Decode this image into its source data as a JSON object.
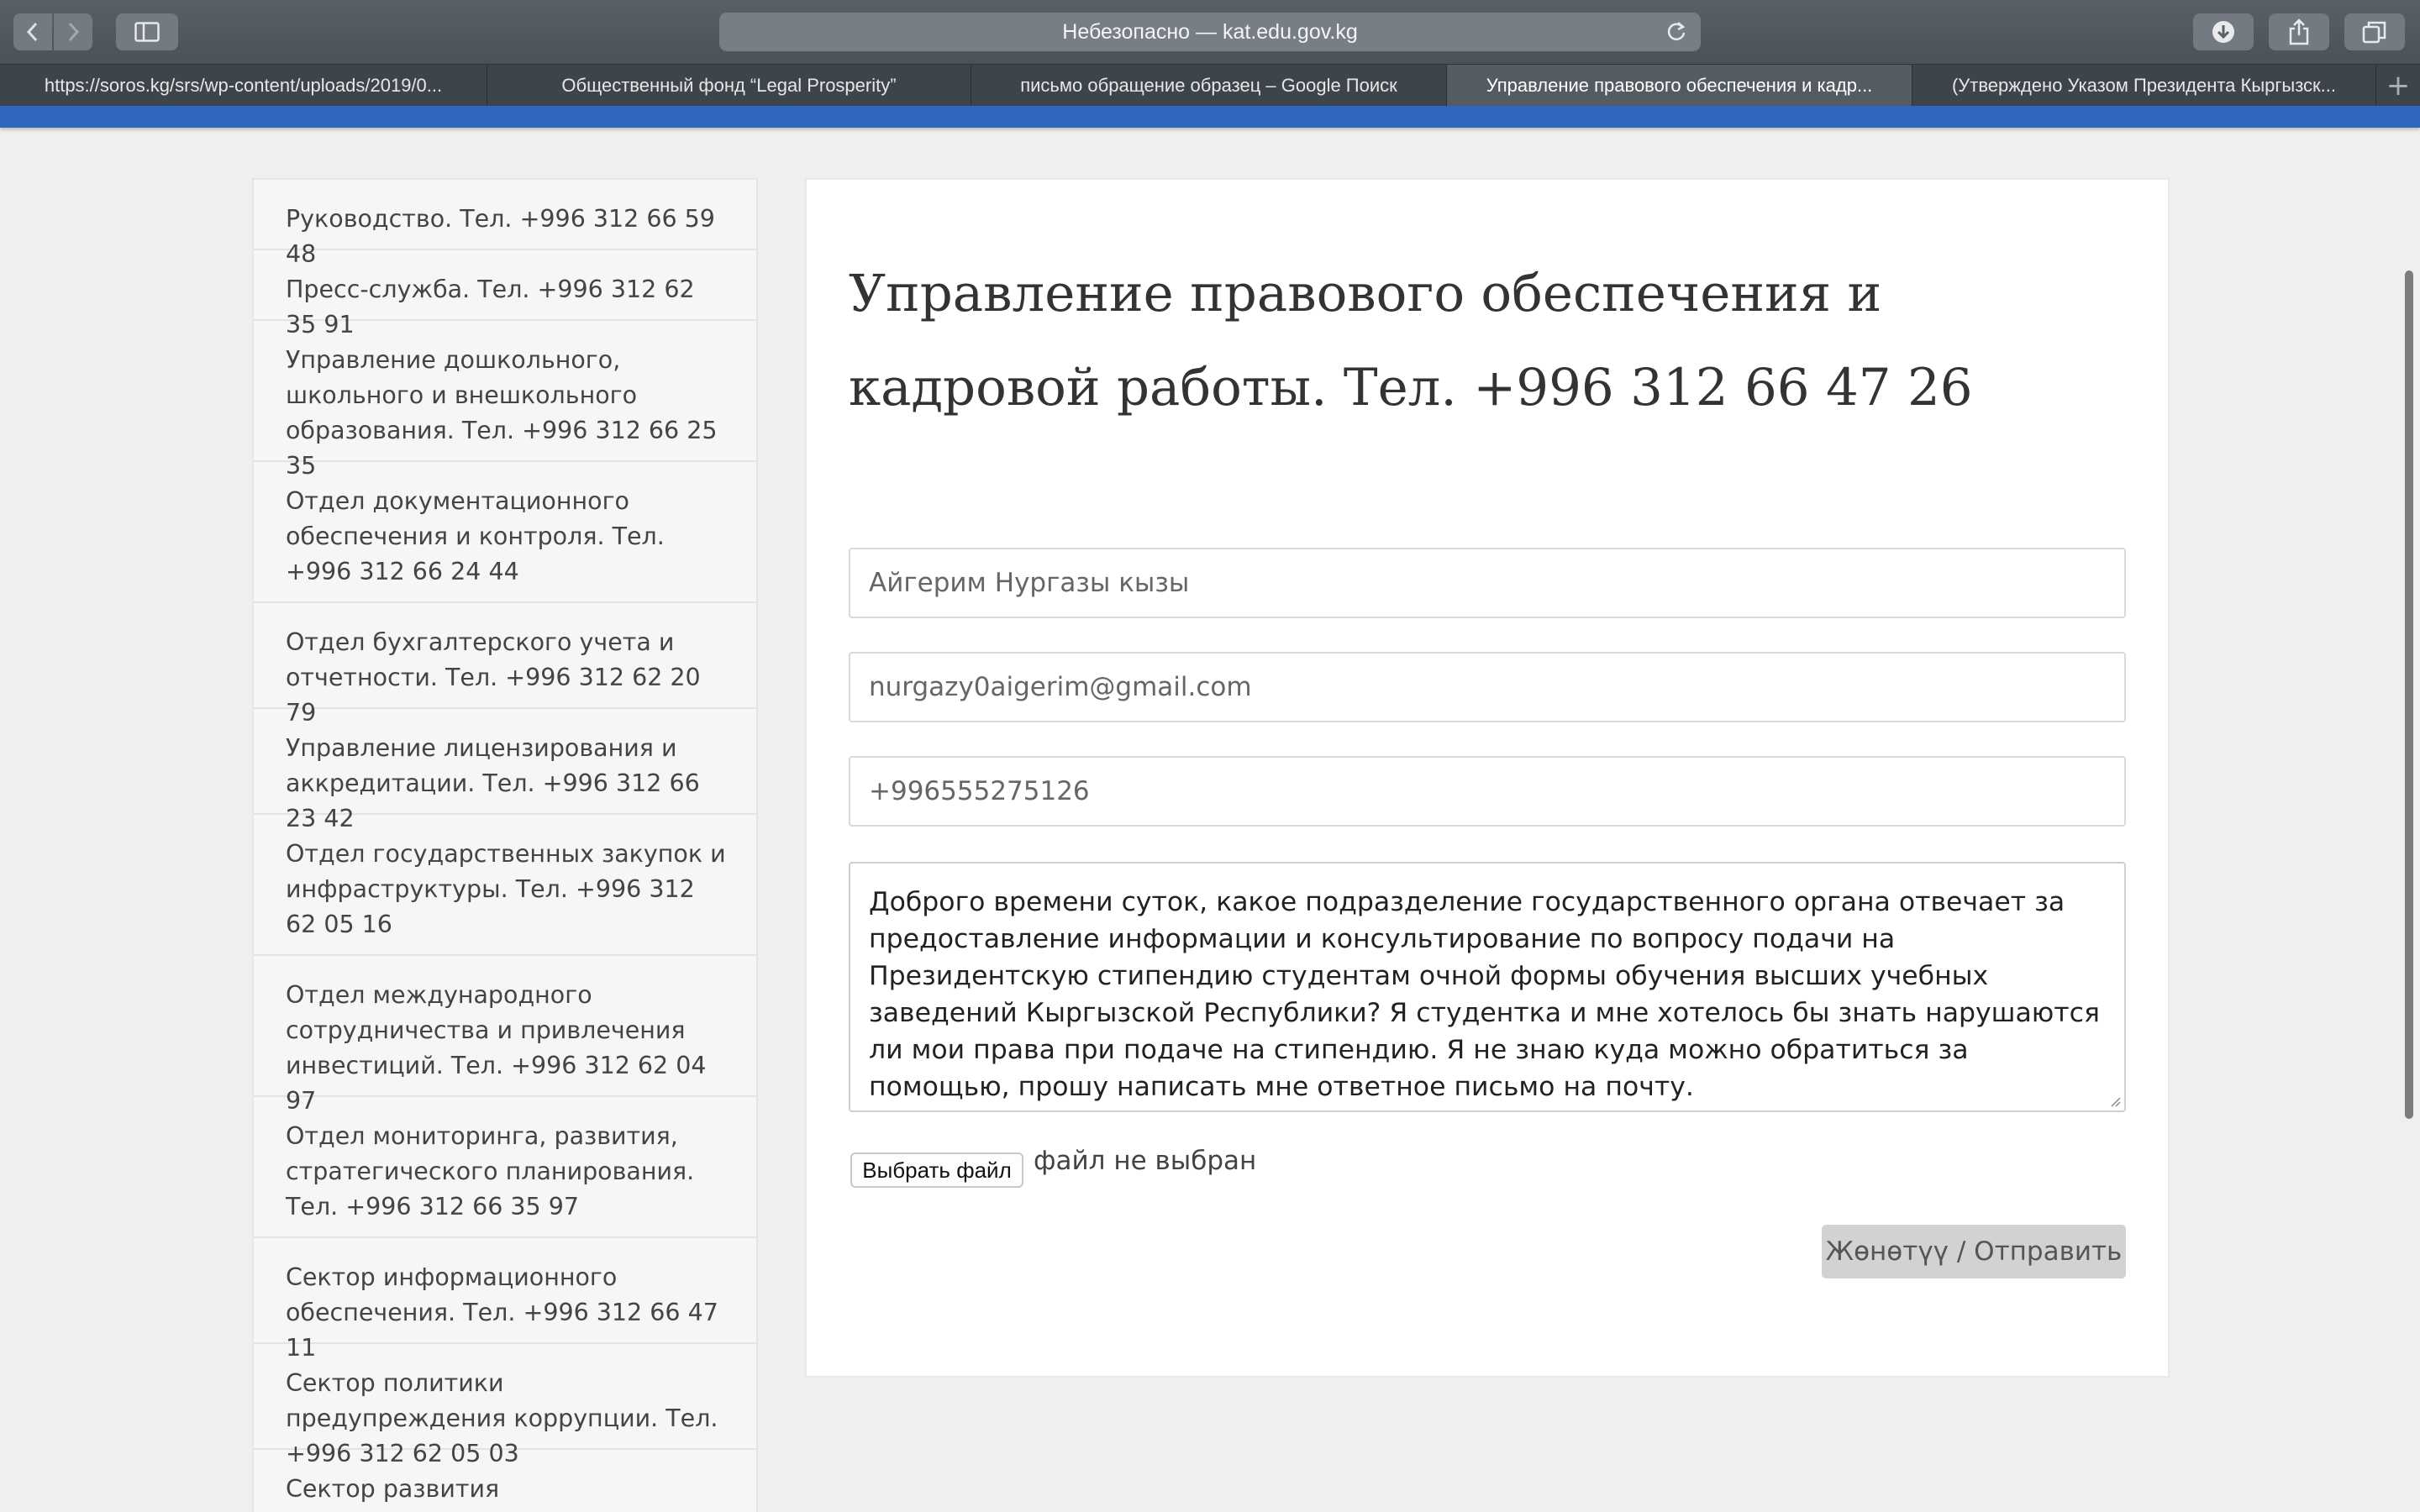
{
  "browser": {
    "address": "Небезопасно — kat.edu.gov.kg",
    "tabs": [
      {
        "label": "https://soros.kg/srs/wp-content/uploads/2019/0...",
        "active": false
      },
      {
        "label": "Общественный фонд “Legal Prosperity”",
        "active": false
      },
      {
        "label": "письмо обращение образец – Google Поиск",
        "active": false
      },
      {
        "label": "Управление правового обеспечения и кадр...",
        "active": true
      },
      {
        "label": "(Утверждено Указом Президента Кыргызск...",
        "active": false
      }
    ],
    "new_tab": "+"
  },
  "sidebar": {
    "items": [
      {
        "label": "Руководство. Тел. +996 312 66 59 48"
      },
      {
        "label": "Пресс-служба. Тел. +996 312 62 35 91"
      },
      {
        "label": "Управление дошкольного, школьного и внешкольного образования. Тел. +996 312 66 25 35"
      },
      {
        "label": "Отдел документационного обеспечения и контроля. Тел. +996 312 66 24 44"
      },
      {
        "label": "Отдел бухгалтерского учета и отчетности. Тел. +996 312 62 20 79"
      },
      {
        "label": "Управление лицензирования и аккредитации. Тел. +996 312 66 23 42"
      },
      {
        "label": "Отдел государственных закупок и инфраструктуры. Тел. +996 312 62 05 16"
      },
      {
        "label": "Отдел международного сотрудничества и привлечения инвестиций. Тел. +996 312 62 04 97"
      },
      {
        "label": "Отдел мониторинга, развития, стратегического планирования. Тел. +996 312 66 35 97"
      },
      {
        "label": "Сектор информационного обеспечения. Тел. +996 312 66 47 11"
      },
      {
        "label": "Сектор политики предупреждения коррупции. Тел. +996 312 62 05 03"
      },
      {
        "label": "Сектор развития государственного"
      }
    ]
  },
  "main": {
    "title": "Управление правового обеспечения и кадровой работы. Тел. +996 312 66 47 26",
    "form": {
      "name_value": "Айгерим Нургазы кызы",
      "email_value": "nurgazy0aigerim@gmail.com",
      "phone_value": "+996555275126",
      "message_value": "Доброго времени суток, какое подразделение государственного органа отвечает за предоставление информации и консультирование по вопросу подачи на Президентскую стипендию студентам очной формы обучения высших учебных заведений Кыргызской Республики? Я студентка и мне хотелось бы знать нарушаются ли мои права при подаче на стипендию. Я не знаю куда можно обратиться за помощью, прошу написать мне ответное письмо на почту.",
      "file_button": "Выбрать файл",
      "file_status": "файл не выбран",
      "submit_label": "Жөнөтүү / Отправить"
    }
  }
}
